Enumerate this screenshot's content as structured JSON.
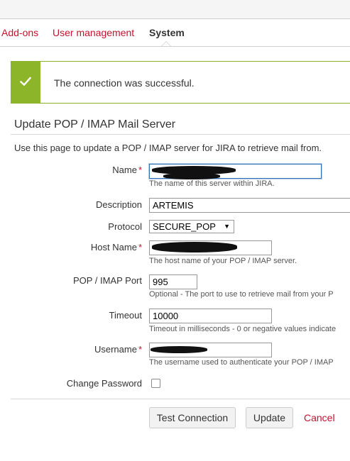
{
  "tabs": [
    {
      "label": "Add-ons",
      "active": false
    },
    {
      "label": "User management",
      "active": false
    },
    {
      "label": "System",
      "active": true
    }
  ],
  "message": {
    "icon": "checkmark-icon",
    "text": "The connection was successful.",
    "color": "#8db52a"
  },
  "page": {
    "title": "Update POP / IMAP Mail Server",
    "description": "Use this page to update a POP / IMAP server for JIRA to retrieve mail from."
  },
  "form": {
    "name": {
      "label": "Name",
      "required": "*",
      "value": "",
      "help": "The name of this server within JIRA."
    },
    "description": {
      "label": "Description",
      "value": "ARTEMIS"
    },
    "protocol": {
      "label": "Protocol",
      "value": "SECURE_POP",
      "arrow": "▼"
    },
    "host": {
      "label": "Host Name",
      "required": "*",
      "value": "",
      "help": "The host name of your POP / IMAP server."
    },
    "port": {
      "label": "POP / IMAP Port",
      "value": "995",
      "help": "Optional - The port to use to retrieve mail from your P"
    },
    "timeout": {
      "label": "Timeout",
      "value": "10000",
      "help": "Timeout in milliseconds - 0 or negative values indicate"
    },
    "username": {
      "label": "Username",
      "required": "*",
      "value": "",
      "help": "The username used to authenticate your POP / IMAP"
    },
    "change_password": {
      "label": "Change Password",
      "checked": false
    }
  },
  "buttons": {
    "test": "Test Connection",
    "update": "Update",
    "cancel": "Cancel"
  },
  "colors": {
    "link": "#c4122f",
    "success": "#8db52a",
    "focus": "#3572b0"
  }
}
